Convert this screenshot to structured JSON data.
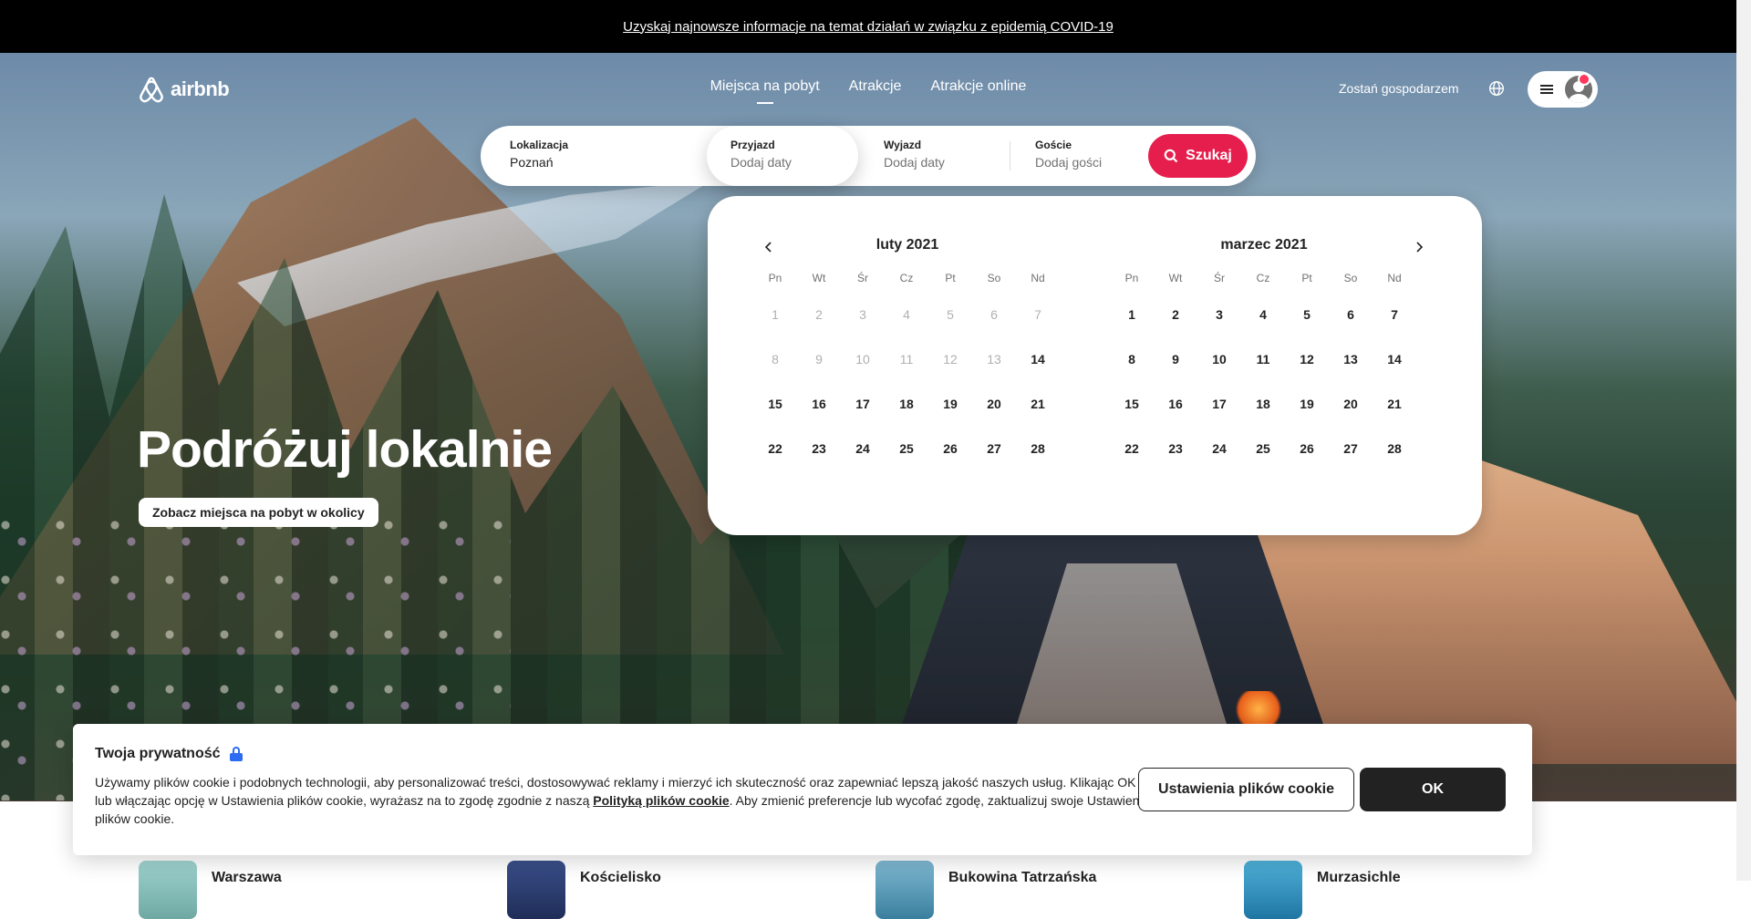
{
  "banner": {
    "link_text": "Uzyskaj najnowsze informacje na temat działań w związku z epidemią COVID-19"
  },
  "brand": {
    "name": "airbnb",
    "color": "#ff385c"
  },
  "nav": {
    "tabs": [
      {
        "label": "Miejsca na pobyt",
        "active": true
      },
      {
        "label": "Atrakcje",
        "active": false
      },
      {
        "label": "Atrakcje online",
        "active": false
      }
    ]
  },
  "header": {
    "host_link": "Zostań gospodarzem",
    "globe_icon": "globe-icon",
    "menu_icon": "hamburger-icon",
    "avatar_icon": "user-avatar-icon",
    "notification_color": "#ff385c"
  },
  "search": {
    "location": {
      "label": "Lokalizacja",
      "value": "Poznań"
    },
    "checkin": {
      "label": "Przyjazd",
      "placeholder": "Dodaj daty"
    },
    "checkout": {
      "label": "Wyjazd",
      "placeholder": "Dodaj daty"
    },
    "guests": {
      "label": "Goście",
      "placeholder": "Dodaj gości"
    },
    "button_label": "Szukaj",
    "button_color": "#e61e4d",
    "button_icon": "search-icon"
  },
  "calendar": {
    "prev_icon": "chevron-left-icon",
    "next_icon": "chevron-right-icon",
    "weekdays": [
      "Pn",
      "Wt",
      "Śr",
      "Cz",
      "Pt",
      "So",
      "Nd"
    ],
    "months": [
      {
        "title": "luty 2021",
        "days": [
          "1",
          "2",
          "3",
          "4",
          "5",
          "6",
          "7",
          "8",
          "9",
          "10",
          "11",
          "12",
          "13",
          "14",
          "15",
          "16",
          "17",
          "18",
          "19",
          "20",
          "21",
          "22",
          "23",
          "24",
          "25",
          "26",
          "27",
          "28"
        ],
        "disabled_through": 13
      },
      {
        "title": "marzec 2021",
        "days": [
          "1",
          "2",
          "3",
          "4",
          "5",
          "6",
          "7",
          "8",
          "9",
          "10",
          "11",
          "12",
          "13",
          "14",
          "15",
          "16",
          "17",
          "18",
          "19",
          "20",
          "21",
          "22",
          "23",
          "24",
          "25",
          "26",
          "27",
          "28"
        ],
        "disabled_through": 0
      }
    ]
  },
  "hero": {
    "title": "Podróżuj lokalnie",
    "button_label": "Zobacz miejsca na pobyt w okolicy"
  },
  "destinations": [
    {
      "name": "Warszawa",
      "thumb_color": "#8fc4c0"
    },
    {
      "name": "Kościelisko",
      "thumb_color": "#2a3d6e"
    },
    {
      "name": "Bukowina Tatrzańska",
      "thumb_color": "#4d8fae"
    },
    {
      "name": "Murzasichle",
      "thumb_color": "#2f8cb8"
    }
  ],
  "cookie": {
    "title": "Twoja prywatność",
    "lock_icon": "lock-icon",
    "text_before": "Używamy plików cookie i podobnych technologii, aby personalizować treści, dostosowywać reklamy i mierzyć ich skuteczność oraz zapewniać lepszą jakość naszych usług. Klikając OK lub włączając opcję w Ustawienia plików cookie, wyrażasz na to zgodę zgodnie z naszą ",
    "link_text": "Polityką plików cookie",
    "text_after": ". Aby zmienić preferencje lub wycofać zgodę, zaktualizuj swoje Ustawienia plików cookie.",
    "settings_button": "Ustawienia plików cookie",
    "ok_button": "OK"
  }
}
